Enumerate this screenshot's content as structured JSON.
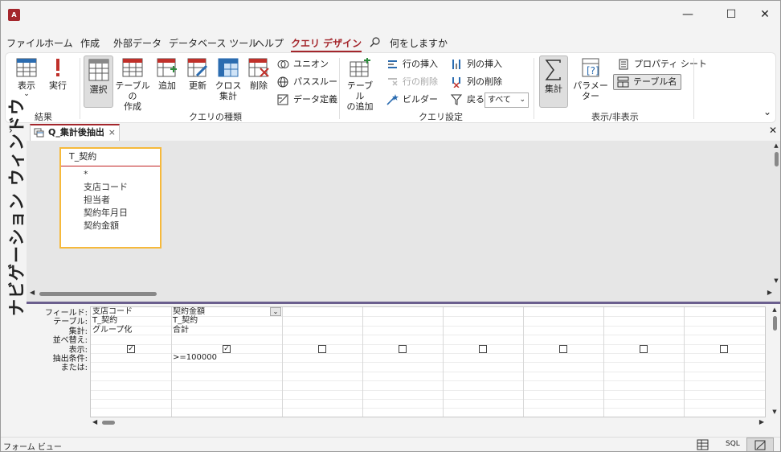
{
  "app": {
    "icon_letter": "A",
    "accent": "#a4262c"
  },
  "window_controls": {
    "minimize": "—",
    "maximize": "☐",
    "close": "✕"
  },
  "menu": {
    "items": [
      "ファイル",
      "ホーム",
      "作成",
      "外部データ",
      "データベース ツール",
      "ヘルプ",
      "クエリ デザイン"
    ],
    "search_label": "何をしますか"
  },
  "ribbon": {
    "view": "表示",
    "run": "実行",
    "results_group": "結果",
    "select": "選択",
    "make_table_1": "テーブルの",
    "make_table_2": "作成",
    "append": "追加",
    "update": "更新",
    "crosstab_1": "クロス",
    "crosstab_2": "集計",
    "delete": "削除",
    "union": "ユニオン",
    "passthrough": "パススルー",
    "data_definition": "データ定義",
    "query_type_group": "クエリの種類",
    "add_table_1": "テーブル",
    "add_table_2": "の追加",
    "insert_rows": "行の挿入",
    "delete_rows": "行の削除",
    "builder": "ビルダー",
    "insert_columns": "列の挿入",
    "delete_columns": "列の削除",
    "return_label": "戻る:",
    "return_value": "すべて",
    "query_setup_group": "クエリ設定",
    "totals": "集計",
    "parameters": "パラメーター",
    "property_sheet": "プロパティ シート",
    "table_names": "テーブル名",
    "show_hide_group": "表示/非表示"
  },
  "nav_pane": {
    "title": "ナビゲーション ウィンドウ"
  },
  "document_tab": {
    "title": "Q_集計後抽出"
  },
  "table_box": {
    "name": "T_契約",
    "fields": [
      "*",
      "支店コード",
      "担当者",
      "契約年月日",
      "契約金額"
    ]
  },
  "grid": {
    "row_labels": [
      "フィールド:",
      "テーブル:",
      "集計:",
      "並べ替え:",
      "表示:",
      "抽出条件:",
      "または:"
    ],
    "columns": [
      {
        "field": "支店コード",
        "table": "T_契約",
        "total": "グループ化",
        "sort": "",
        "show": true,
        "criteria": ""
      },
      {
        "field": "契約金額",
        "table": "T_契約",
        "total": "合計",
        "sort": "",
        "show": true,
        "criteria": ">=100000"
      },
      {
        "field": "",
        "table": "",
        "total": "",
        "sort": "",
        "show": false,
        "criteria": ""
      },
      {
        "field": "",
        "table": "",
        "total": "",
        "sort": "",
        "show": false,
        "criteria": ""
      },
      {
        "field": "",
        "table": "",
        "total": "",
        "sort": "",
        "show": false,
        "criteria": ""
      },
      {
        "field": "",
        "table": "",
        "total": "",
        "sort": "",
        "show": false,
        "criteria": ""
      },
      {
        "field": "",
        "table": "",
        "total": "",
        "sort": "",
        "show": false,
        "criteria": ""
      },
      {
        "field": "",
        "table": "",
        "total": "",
        "sort": "",
        "show": false,
        "criteria": ""
      }
    ]
  },
  "status": {
    "left": "フォーム ビュー",
    "sql": "SQL"
  }
}
